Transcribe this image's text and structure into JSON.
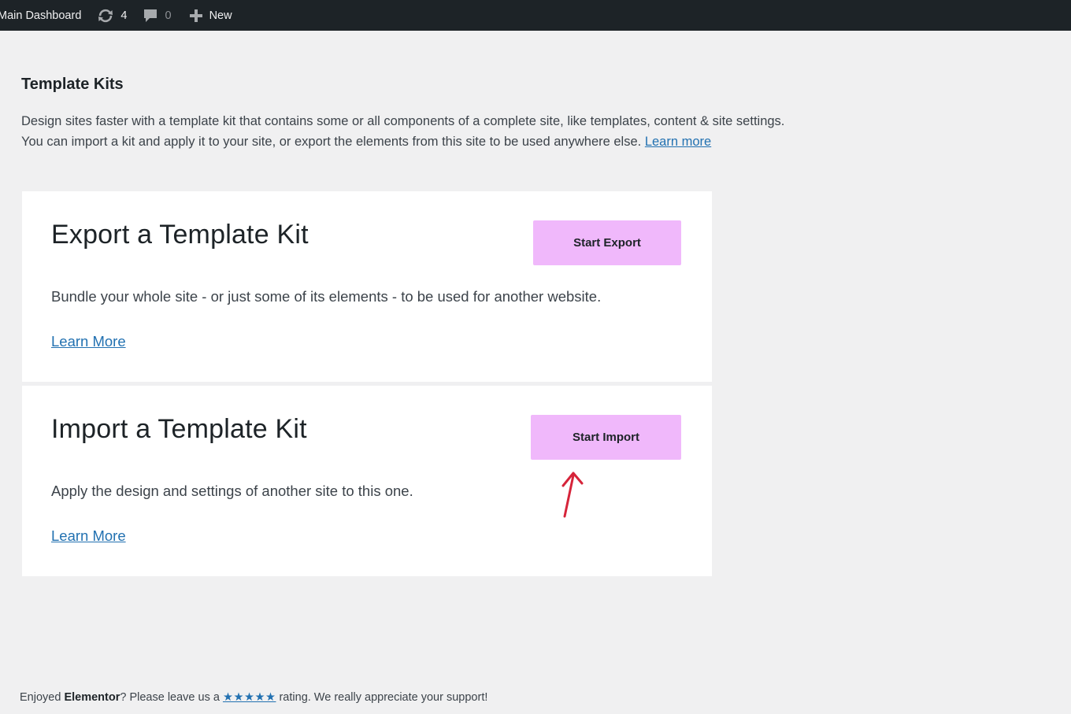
{
  "admin_bar": {
    "site_name": "Main Dashboard",
    "updates_count": "4",
    "comments_count": "0",
    "new_label": "New"
  },
  "page": {
    "title": "Template Kits",
    "intro_line1": "Design sites faster with a template kit that contains some or all components of a complete site, like templates, content & site settings.",
    "intro_line2": "You can import a kit and apply it to your site, or export the elements from this site to be used anywhere else.",
    "intro_link": "Learn more"
  },
  "export_card": {
    "title": "Export a Template Kit",
    "button": "Start Export",
    "description": "Bundle your whole site - or just some of its elements - to be used for another website.",
    "link": "Learn More"
  },
  "import_card": {
    "title": "Import a Template Kit",
    "button": "Start Import",
    "description": "Apply the design and settings of another site to this one.",
    "link": "Learn More"
  },
  "footer": {
    "prefix": "Enjoyed ",
    "brand": "Elementor",
    "middle": "? Please leave us a ",
    "rating_link": "★★★★★",
    "suffix": " rating. We really appreciate your support!"
  },
  "colors": {
    "admin_bar_bg": "#1d2327",
    "page_bg": "#f0f0f1",
    "button_bg": "#f0b8fb",
    "link": "#2271b1",
    "annotation_arrow": "#d6243a"
  },
  "icons": {
    "updates": "refresh-icon",
    "comments": "comment-bubble-icon",
    "new": "plus-icon",
    "annotation": "red-arrow-icon"
  }
}
